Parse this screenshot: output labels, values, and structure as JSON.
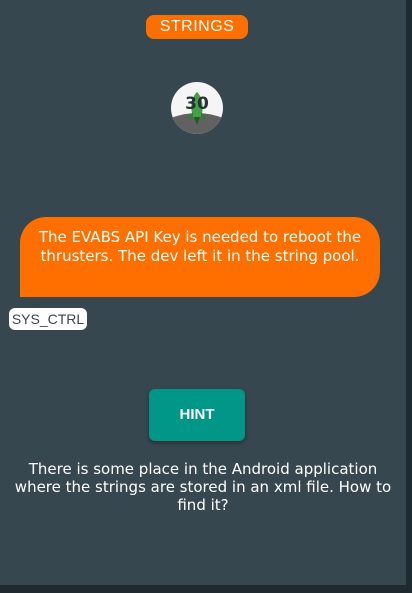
{
  "header": {
    "title": "STRINGS"
  },
  "level_icon": {
    "number": "30",
    "icon": "rocket-icon"
  },
  "dialog": {
    "message": "The EVABS API Key is needed to reboot the thrusters. The dev left it in the string pool.",
    "speaker": "SYS_CTRL"
  },
  "hint_button": {
    "label": "HINT"
  },
  "hint": {
    "text": "There is some place in the Android application where the strings are stored in an xml file. How to find it?"
  },
  "colors": {
    "background": "#37474f",
    "accent": "#ff6f00",
    "button": "#009688",
    "text": "#ffffff"
  }
}
